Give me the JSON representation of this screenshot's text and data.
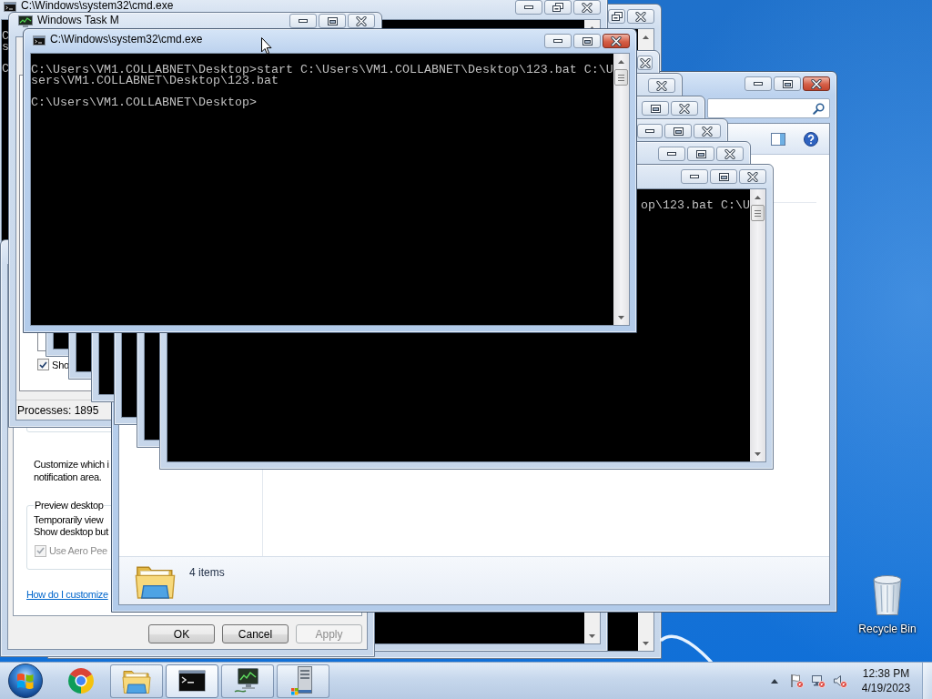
{
  "desktop": {
    "icons": [
      {
        "kind": "recycle-bin",
        "label": "Recycle Bin"
      }
    ]
  },
  "windows": [
    {
      "kind": "console",
      "title": "C:\\Windows\\system32\\cmd.exe",
      "active": false,
      "maximized": true,
      "lines_cut_left": false,
      "blocks": [
        [
          "C",
          "s"
        ],
        [
          "C"
        ]
      ]
    },
    {
      "kind": "console",
      "active": false,
      "maximized": true
    },
    {
      "kind": "task-manager",
      "title": "Windows Task M",
      "active": false,
      "maximized": false,
      "checkbox": {
        "label": "Sho",
        "checked": true
      },
      "status": "Processes: 1895"
    },
    {
      "kind": "console",
      "title": "C:\\Windows\\system32\\cmd.exe",
      "active": true,
      "maximized": false,
      "lines_cut_left": false,
      "blocks": [
        [
          "C:\\Users\\VM1.COLLABNET\\Desktop>start C:\\Users\\VM1.COLLABNET\\Desktop\\123.bat C:\\U",
          "sers\\VM1.COLLABNET\\Desktop\\123.bat"
        ],
        [
          "C:\\Users\\VM1.COLLABNET\\Desktop>"
        ]
      ]
    },
    {
      "kind": "console",
      "active": false
    },
    {
      "kind": "console",
      "active": false
    },
    {
      "kind": "console",
      "active": false,
      "maximized": false
    },
    {
      "kind": "console",
      "active": false,
      "maximized": false
    },
    {
      "kind": "console",
      "active": false,
      "maximized": false
    },
    {
      "kind": "console",
      "active": false,
      "maximized": false,
      "lines_cut_left": true,
      "blocks": [
        [
          "op\\123.bat C:\\U"
        ]
      ]
    },
    {
      "kind": "properties-dialog",
      "notification_text": [
        "Customize which i",
        "notification area."
      ],
      "peek_group": {
        "title": "Preview desktop",
        "text": [
          "Temporarily view",
          "Show desktop but"
        ],
        "checkbox": {
          "label": "Use Aero Pee",
          "checked": true,
          "disabled": true
        }
      },
      "help_link": "How do I customize",
      "buttons": [
        {
          "label": "OK",
          "disabled": false
        },
        {
          "label": "Cancel",
          "disabled": false
        },
        {
          "label": "Apply",
          "disabled": true
        }
      ]
    },
    {
      "kind": "explorer",
      "active": true,
      "maximized": false,
      "status": "4 items"
    }
  ],
  "taskbar": {
    "items": [
      {
        "kind": "browser",
        "running": false,
        "active": false
      },
      {
        "kind": "files",
        "running": true,
        "active": false
      },
      {
        "kind": "terminal",
        "running": true,
        "active": true
      },
      {
        "kind": "monitor",
        "running": true,
        "active": false
      },
      {
        "kind": "server",
        "running": true,
        "active": false
      }
    ],
    "tray": {
      "icons": [
        {
          "kind": "notifications",
          "error": true
        },
        {
          "kind": "network",
          "error": true
        },
        {
          "kind": "volume",
          "error": true
        }
      ],
      "time": "12:38 PM",
      "date": "4/19/2023"
    }
  }
}
